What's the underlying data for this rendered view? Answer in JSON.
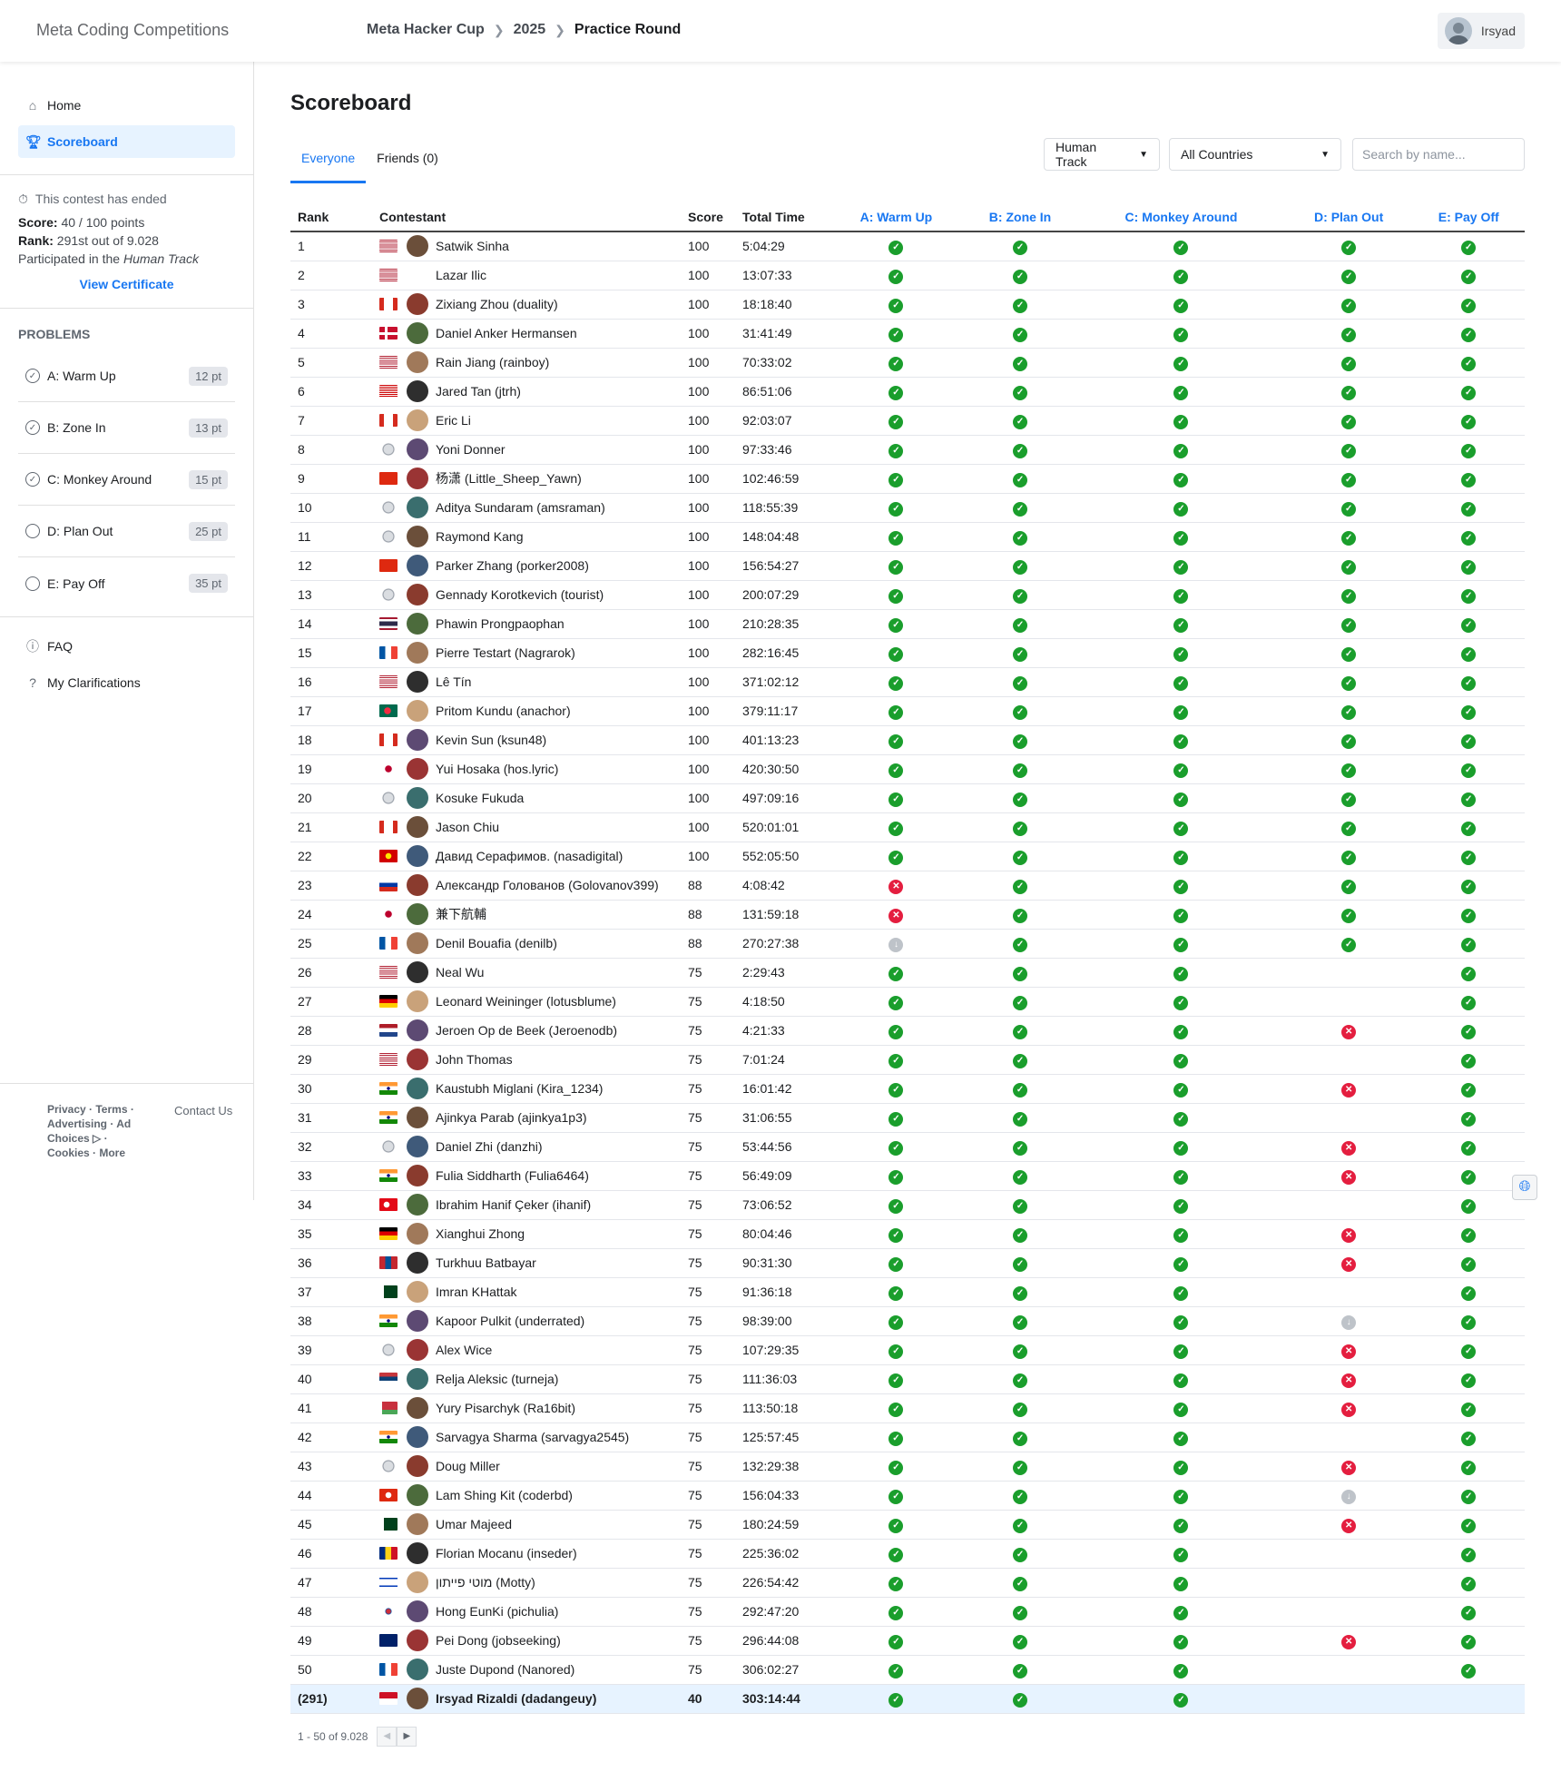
{
  "header": {
    "brand": "Meta Coding Competitions",
    "crumbs": [
      "Meta Hacker Cup",
      "2025",
      "Practice Round"
    ],
    "user": "Irsyad"
  },
  "nav": {
    "home": "Home",
    "scoreboard": "Scoreboard"
  },
  "status": {
    "ended": "This contest has ended",
    "score_label": "Score:",
    "score_value": "40 / 100 points",
    "rank_label": "Rank:",
    "rank_value": "291st out of 9.028",
    "track_prefix": "Participated in the",
    "track": "Human Track",
    "cert": "View Certificate"
  },
  "problems": {
    "heading": "PROBLEMS",
    "items": [
      {
        "label": "A: Warm Up",
        "pt": "12 pt",
        "solved": true
      },
      {
        "label": "B: Zone In",
        "pt": "13 pt",
        "solved": true
      },
      {
        "label": "C: Monkey Around",
        "pt": "15 pt",
        "solved": true
      },
      {
        "label": "D: Plan Out",
        "pt": "25 pt",
        "solved": false
      },
      {
        "label": "E: Pay Off",
        "pt": "35 pt",
        "solved": false
      }
    ]
  },
  "links": {
    "faq": "FAQ",
    "clar": "My Clarifications"
  },
  "footer": {
    "links": "Privacy · Terms · Advertising · Ad Choices ▷ · Cookies · More",
    "contact": "Contact Us"
  },
  "main": {
    "title": "Scoreboard",
    "tabs": [
      "Everyone",
      "Friends (0)"
    ],
    "track_select": "Human Track",
    "country_select": "All Countries",
    "search_placeholder": "Search by name..."
  },
  "columns": [
    "Rank",
    "Contestant",
    "Score",
    "Total Time",
    "A: Warm Up",
    "B: Zone In",
    "C: Monkey Around",
    "D: Plan Out",
    "E: Pay Off"
  ],
  "colors": {
    "accent": "#1877f2",
    "ok": "#1a9e2c",
    "fail": "#e41e3f",
    "pending": "#bec3c9"
  },
  "rows": [
    {
      "rank": "1",
      "flag": "us",
      "name": "Satwik Sinha",
      "score": "100",
      "time": "5:04:29",
      "p": [
        "ok",
        "ok",
        "ok",
        "ok",
        "ok"
      ]
    },
    {
      "rank": "2",
      "flag": "us",
      "name": "Lazar Ilic",
      "score": "100",
      "time": "13:07:33",
      "p": [
        "ok",
        "ok",
        "ok",
        "ok",
        "ok"
      ],
      "noav": true
    },
    {
      "rank": "3",
      "flag": "ca",
      "name": "Zixiang Zhou (duality)",
      "score": "100",
      "time": "18:18:40",
      "p": [
        "ok",
        "ok",
        "ok",
        "ok",
        "ok"
      ]
    },
    {
      "rank": "4",
      "flag": "dk",
      "name": "Daniel Anker Hermansen",
      "score": "100",
      "time": "31:41:49",
      "p": [
        "ok",
        "ok",
        "ok",
        "ok",
        "ok"
      ]
    },
    {
      "rank": "5",
      "flag": "us",
      "name": "Rain Jiang (rainboy)",
      "score": "100",
      "time": "70:33:02",
      "p": [
        "ok",
        "ok",
        "ok",
        "ok",
        "ok"
      ]
    },
    {
      "rank": "6",
      "flag": "my",
      "name": "Jared Tan (jtrh)",
      "score": "100",
      "time": "86:51:06",
      "p": [
        "ok",
        "ok",
        "ok",
        "ok",
        "ok"
      ]
    },
    {
      "rank": "7",
      "flag": "ca",
      "name": "Eric Li",
      "score": "100",
      "time": "92:03:07",
      "p": [
        "ok",
        "ok",
        "ok",
        "ok",
        "ok"
      ]
    },
    {
      "rank": "8",
      "flag": "globe",
      "name": "Yoni Donner",
      "score": "100",
      "time": "97:33:46",
      "p": [
        "ok",
        "ok",
        "ok",
        "ok",
        "ok"
      ]
    },
    {
      "rank": "9",
      "flag": "cn",
      "name": "杨潇 (Little_Sheep_Yawn)",
      "score": "100",
      "time": "102:46:59",
      "p": [
        "ok",
        "ok",
        "ok",
        "ok",
        "ok"
      ]
    },
    {
      "rank": "10",
      "flag": "globe",
      "name": "Aditya Sundaram (amsraman)",
      "score": "100",
      "time": "118:55:39",
      "p": [
        "ok",
        "ok",
        "ok",
        "ok",
        "ok"
      ]
    },
    {
      "rank": "11",
      "flag": "globe",
      "name": "Raymond Kang",
      "score": "100",
      "time": "148:04:48",
      "p": [
        "ok",
        "ok",
        "ok",
        "ok",
        "ok"
      ]
    },
    {
      "rank": "12",
      "flag": "cn",
      "name": "Parker Zhang (porker2008)",
      "score": "100",
      "time": "156:54:27",
      "p": [
        "ok",
        "ok",
        "ok",
        "ok",
        "ok"
      ]
    },
    {
      "rank": "13",
      "flag": "globe",
      "name": "Gennady Korotkevich (tourist)",
      "score": "100",
      "time": "200:07:29",
      "p": [
        "ok",
        "ok",
        "ok",
        "ok",
        "ok"
      ]
    },
    {
      "rank": "14",
      "flag": "th",
      "name": "Phawin Prongpaophan",
      "score": "100",
      "time": "210:28:35",
      "p": [
        "ok",
        "ok",
        "ok",
        "ok",
        "ok"
      ]
    },
    {
      "rank": "15",
      "flag": "fr",
      "name": "Pierre Testart (Nagrarok)",
      "score": "100",
      "time": "282:16:45",
      "p": [
        "ok",
        "ok",
        "ok",
        "ok",
        "ok"
      ]
    },
    {
      "rank": "16",
      "flag": "us",
      "name": "Lê Tín",
      "score": "100",
      "time": "371:02:12",
      "p": [
        "ok",
        "ok",
        "ok",
        "ok",
        "ok"
      ]
    },
    {
      "rank": "17",
      "flag": "bd",
      "name": "Pritom Kundu (anachor)",
      "score": "100",
      "time": "379:11:17",
      "p": [
        "ok",
        "ok",
        "ok",
        "ok",
        "ok"
      ]
    },
    {
      "rank": "18",
      "flag": "ca",
      "name": "Kevin Sun (ksun48)",
      "score": "100",
      "time": "401:13:23",
      "p": [
        "ok",
        "ok",
        "ok",
        "ok",
        "ok"
      ]
    },
    {
      "rank": "19",
      "flag": "jp",
      "name": "Yui Hosaka (hos.lyric)",
      "score": "100",
      "time": "420:30:50",
      "p": [
        "ok",
        "ok",
        "ok",
        "ok",
        "ok"
      ]
    },
    {
      "rank": "20",
      "flag": "globe",
      "name": "Kosuke Fukuda",
      "score": "100",
      "time": "497:09:16",
      "p": [
        "ok",
        "ok",
        "ok",
        "ok",
        "ok"
      ]
    },
    {
      "rank": "21",
      "flag": "ca",
      "name": "Jason Chiu",
      "score": "100",
      "time": "520:01:01",
      "p": [
        "ok",
        "ok",
        "ok",
        "ok",
        "ok"
      ]
    },
    {
      "rank": "22",
      "flag": "mk",
      "name": "Давид Серафимов. (nasadigital)",
      "score": "100",
      "time": "552:05:50",
      "p": [
        "ok",
        "ok",
        "ok",
        "ok",
        "ok"
      ]
    },
    {
      "rank": "23",
      "flag": "ru",
      "name": "Александр Голованов (Golovanov399)",
      "score": "88",
      "time": "4:08:42",
      "p": [
        "bad",
        "ok",
        "ok",
        "ok",
        "ok"
      ]
    },
    {
      "rank": "24",
      "flag": "jp",
      "name": "兼下航輔",
      "score": "88",
      "time": "131:59:18",
      "p": [
        "bad",
        "ok",
        "ok",
        "ok",
        "ok"
      ]
    },
    {
      "rank": "25",
      "flag": "fr",
      "name": "Denil Bouafia (denilb)",
      "score": "88",
      "time": "270:27:38",
      "p": [
        "pend",
        "ok",
        "ok",
        "ok",
        "ok"
      ]
    },
    {
      "rank": "26",
      "flag": "us",
      "name": "Neal Wu",
      "score": "75",
      "time": "2:29:43",
      "p": [
        "ok",
        "ok",
        "ok",
        "",
        "ok"
      ]
    },
    {
      "rank": "27",
      "flag": "de",
      "name": "Leonard Weininger (lotusblume)",
      "score": "75",
      "time": "4:18:50",
      "p": [
        "ok",
        "ok",
        "ok",
        "",
        "ok"
      ]
    },
    {
      "rank": "28",
      "flag": "nl",
      "name": "Jeroen Op de Beek (Jeroenodb)",
      "score": "75",
      "time": "4:21:33",
      "p": [
        "ok",
        "ok",
        "ok",
        "bad",
        "ok"
      ]
    },
    {
      "rank": "29",
      "flag": "us",
      "name": "John Thomas",
      "score": "75",
      "time": "7:01:24",
      "p": [
        "ok",
        "ok",
        "ok",
        "",
        "ok"
      ]
    },
    {
      "rank": "30",
      "flag": "in",
      "name": "Kaustubh Miglani (Kira_1234)",
      "score": "75",
      "time": "16:01:42",
      "p": [
        "ok",
        "ok",
        "ok",
        "bad",
        "ok"
      ]
    },
    {
      "rank": "31",
      "flag": "in",
      "name": "Ajinkya Parab (ajinkya1p3)",
      "score": "75",
      "time": "31:06:55",
      "p": [
        "ok",
        "ok",
        "ok",
        "",
        "ok"
      ]
    },
    {
      "rank": "32",
      "flag": "globe",
      "name": "Daniel Zhi (danzhi)",
      "score": "75",
      "time": "53:44:56",
      "p": [
        "ok",
        "ok",
        "ok",
        "bad",
        "ok"
      ]
    },
    {
      "rank": "33",
      "flag": "in",
      "name": "Fulia Siddharth (Fulia6464)",
      "score": "75",
      "time": "56:49:09",
      "p": [
        "ok",
        "ok",
        "ok",
        "bad",
        "ok"
      ]
    },
    {
      "rank": "34",
      "flag": "tr",
      "name": "Ibrahim Hanif Çeker (ihanif)",
      "score": "75",
      "time": "73:06:52",
      "p": [
        "ok",
        "ok",
        "ok",
        "",
        "ok"
      ]
    },
    {
      "rank": "35",
      "flag": "de",
      "name": "Xianghui Zhong",
      "score": "75",
      "time": "80:04:46",
      "p": [
        "ok",
        "ok",
        "ok",
        "bad",
        "ok"
      ]
    },
    {
      "rank": "36",
      "flag": "mn",
      "name": "Turkhuu Batbayar",
      "score": "75",
      "time": "90:31:30",
      "p": [
        "ok",
        "ok",
        "ok",
        "bad",
        "ok"
      ]
    },
    {
      "rank": "37",
      "flag": "pk",
      "name": "Imran KHattak",
      "score": "75",
      "time": "91:36:18",
      "p": [
        "ok",
        "ok",
        "ok",
        "",
        "ok"
      ]
    },
    {
      "rank": "38",
      "flag": "in",
      "name": "Kapoor Pulkit (underrated)",
      "score": "75",
      "time": "98:39:00",
      "p": [
        "ok",
        "ok",
        "ok",
        "pend",
        "ok"
      ]
    },
    {
      "rank": "39",
      "flag": "globe",
      "name": "Alex Wice",
      "score": "75",
      "time": "107:29:35",
      "p": [
        "ok",
        "ok",
        "ok",
        "bad",
        "ok"
      ]
    },
    {
      "rank": "40",
      "flag": "rs",
      "name": "Relja Aleksic (turneja)",
      "score": "75",
      "time": "111:36:03",
      "p": [
        "ok",
        "ok",
        "ok",
        "bad",
        "ok"
      ]
    },
    {
      "rank": "41",
      "flag": "by",
      "name": "Yury Pisarchyk (Ra16bit)",
      "score": "75",
      "time": "113:50:18",
      "p": [
        "ok",
        "ok",
        "ok",
        "bad",
        "ok"
      ]
    },
    {
      "rank": "42",
      "flag": "in",
      "name": "Sarvagya Sharma (sarvagya2545)",
      "score": "75",
      "time": "125:57:45",
      "p": [
        "ok",
        "ok",
        "ok",
        "",
        "ok"
      ]
    },
    {
      "rank": "43",
      "flag": "globe",
      "name": "Doug Miller",
      "score": "75",
      "time": "132:29:38",
      "p": [
        "ok",
        "ok",
        "ok",
        "bad",
        "ok"
      ]
    },
    {
      "rank": "44",
      "flag": "hk",
      "name": "Lam Shing Kit (coderbd)",
      "score": "75",
      "time": "156:04:33",
      "p": [
        "ok",
        "ok",
        "ok",
        "pend",
        "ok"
      ]
    },
    {
      "rank": "45",
      "flag": "pk",
      "name": "Umar Majeed",
      "score": "75",
      "time": "180:24:59",
      "p": [
        "ok",
        "ok",
        "ok",
        "bad",
        "ok"
      ]
    },
    {
      "rank": "46",
      "flag": "ro",
      "name": "Florian Mocanu (inseder)",
      "score": "75",
      "time": "225:36:02",
      "p": [
        "ok",
        "ok",
        "ok",
        "",
        "ok"
      ]
    },
    {
      "rank": "47",
      "flag": "il",
      "name": "מוטי פייתון (Motty)",
      "score": "75",
      "time": "226:54:42",
      "p": [
        "ok",
        "ok",
        "ok",
        "",
        "ok"
      ]
    },
    {
      "rank": "48",
      "flag": "kr",
      "name": "Hong EunKi (pichulia)",
      "score": "75",
      "time": "292:47:20",
      "p": [
        "ok",
        "ok",
        "ok",
        "",
        "ok"
      ]
    },
    {
      "rank": "49",
      "flag": "au",
      "name": "Pei Dong (jobseeking)",
      "score": "75",
      "time": "296:44:08",
      "p": [
        "ok",
        "ok",
        "ok",
        "bad",
        "ok"
      ]
    },
    {
      "rank": "50",
      "flag": "fr",
      "name": "Juste Dupond (Nanored)",
      "score": "75",
      "time": "306:02:27",
      "p": [
        "ok",
        "ok",
        "ok",
        "",
        "ok"
      ]
    },
    {
      "rank": "(291)",
      "flag": "id",
      "name": "Irsyad Rizaldi (dadangeuy)",
      "score": "40",
      "time": "303:14:44",
      "p": [
        "ok",
        "ok",
        "ok",
        "",
        ""
      ],
      "me": true
    }
  ],
  "pager": {
    "text": "1 - 50 of 9.028"
  }
}
